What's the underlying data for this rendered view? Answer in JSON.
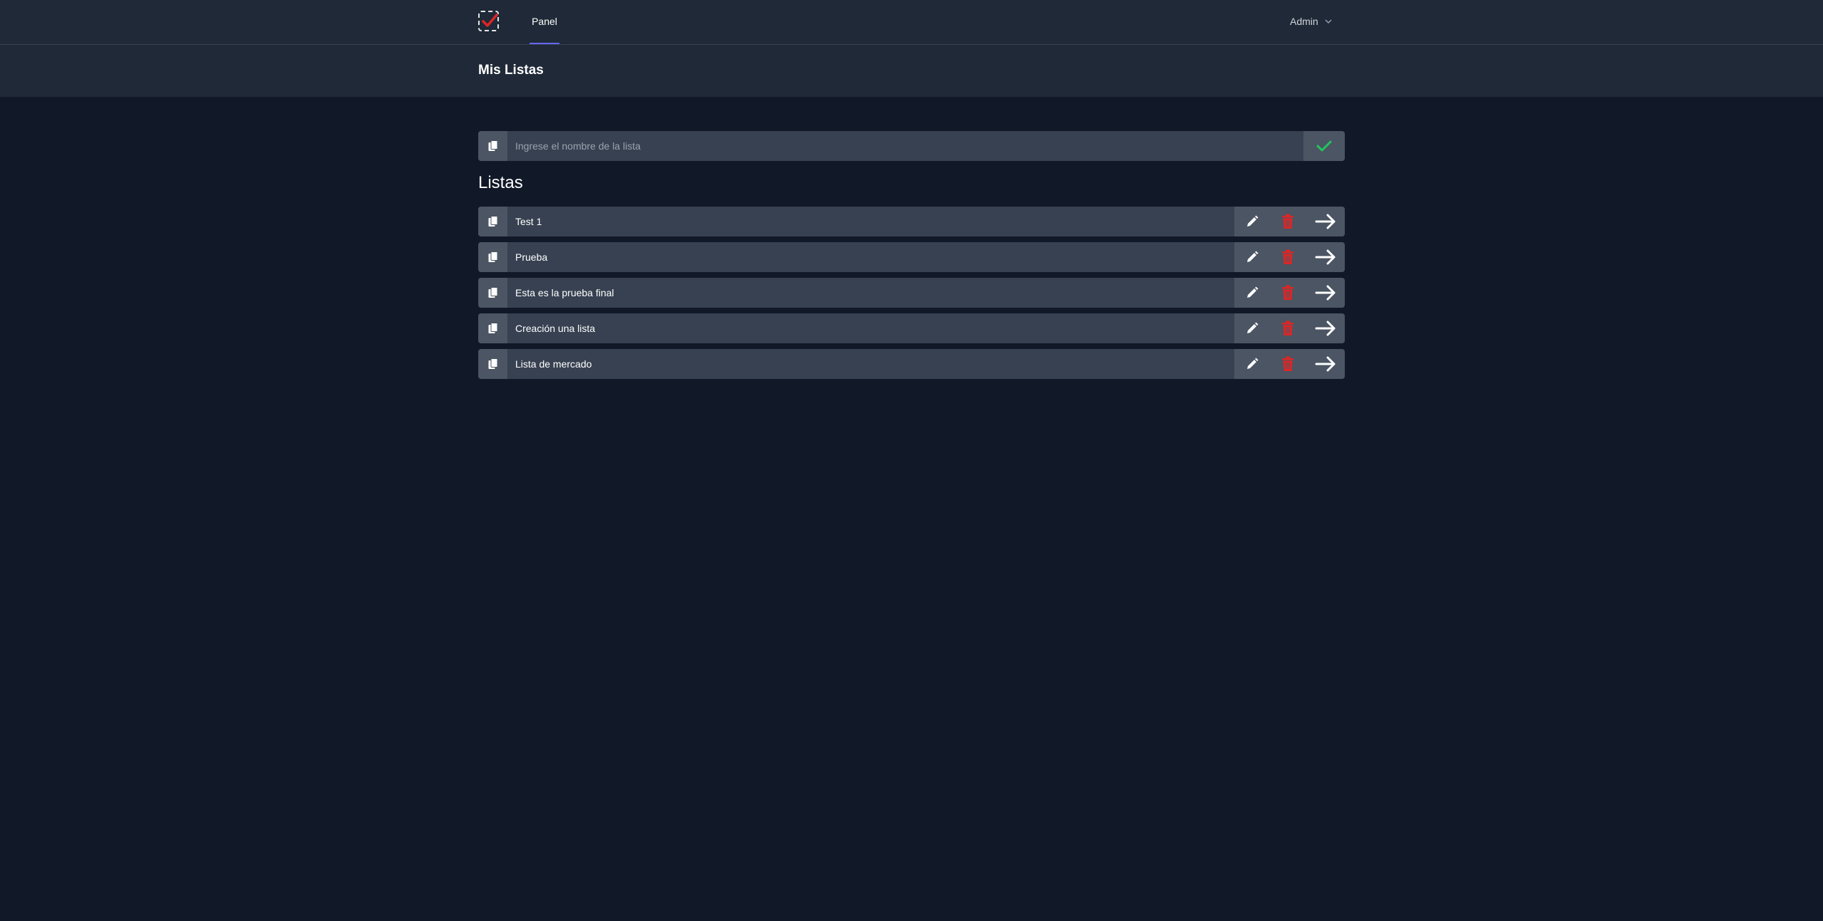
{
  "nav": {
    "tabs": [
      {
        "label": "Panel"
      }
    ],
    "user": {
      "label": "Admin"
    }
  },
  "header": {
    "title": "Mis Listas"
  },
  "new_list": {
    "placeholder": "Ingrese el nombre de la lista"
  },
  "section": {
    "title": "Listas"
  },
  "lists": [
    {
      "name": "Test 1"
    },
    {
      "name": "Prueba"
    },
    {
      "name": "Esta es la prueba final"
    },
    {
      "name": "Creación una lista"
    },
    {
      "name": "Lista de mercado"
    }
  ],
  "icons": {
    "logo": "check-logo-icon",
    "list": "copy-icon",
    "confirm": "check-icon",
    "edit": "pencil-icon",
    "delete": "trash-icon",
    "open": "arrow-right-icon",
    "user_menu": "chevron-down-icon"
  },
  "colors": {
    "background": "#111827",
    "bar": "#1f2937",
    "row": "#374151",
    "accent": "#6366f1",
    "delete": "#dc2626",
    "confirm": "#22c55e"
  }
}
